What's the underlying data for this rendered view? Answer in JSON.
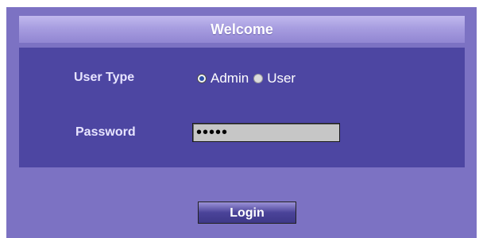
{
  "header": {
    "title": "Welcome"
  },
  "form": {
    "user_type_label": "User Type",
    "user_type_options": [
      {
        "label": "Admin",
        "selected": true
      },
      {
        "label": "User",
        "selected": false
      }
    ],
    "password_label": "Password",
    "password_value": "•••••"
  },
  "actions": {
    "login_label": "Login"
  },
  "colors": {
    "frame": "#7c72c3",
    "header": "#a79de0",
    "panel": "#4d46a2",
    "input": "#c6c6c6",
    "button": "#4a4399"
  }
}
